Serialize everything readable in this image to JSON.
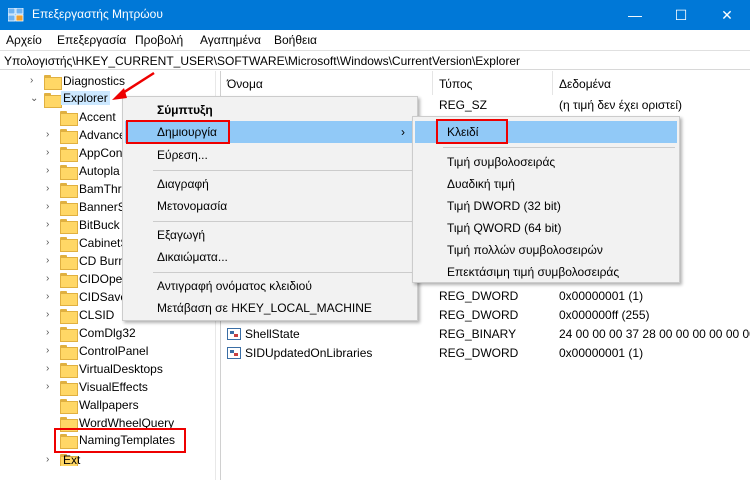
{
  "window": {
    "title": "Επεξεργαστής Μητρώου",
    "minimize": "—",
    "maximize": "☐",
    "close": "✕"
  },
  "menu": [
    "Αρχείο",
    "Επεξεργασία",
    "Προβολή",
    "Αγαπημένα",
    "Βοήθεια"
  ],
  "address": "Υπολογιστής\\HKEY_CURRENT_USER\\SOFTWARE\\Microsoft\\Windows\\CurrentVersion\\Explorer",
  "tree": {
    "items": [
      {
        "label": "Diagnostics",
        "chevron": "›"
      },
      {
        "label": "Explorer",
        "chevron": "⌄",
        "selected": true
      },
      {
        "label": "Accent",
        "chevron": ""
      },
      {
        "label": "Advance",
        "chevron": "›"
      },
      {
        "label": "AppCon",
        "chevron": "›"
      },
      {
        "label": "Autopla",
        "chevron": "›"
      },
      {
        "label": "BamThr",
        "chevron": "›"
      },
      {
        "label": "BannerS",
        "chevron": "›"
      },
      {
        "label": "BitBuck",
        "chevron": "›"
      },
      {
        "label": "CabinetS",
        "chevron": "›"
      },
      {
        "label": "CD Burn",
        "chevron": "›"
      },
      {
        "label": "CIDOper",
        "chevron": "›"
      },
      {
        "label": "CIDSave",
        "chevron": "›"
      },
      {
        "label": "CLSID",
        "chevron": "›"
      },
      {
        "label": "ComDlg32",
        "chevron": "›"
      },
      {
        "label": "ControlPanel",
        "chevron": "›"
      },
      {
        "label": "VirtualDesktops",
        "chevron": "›"
      },
      {
        "label": "VisualEffects",
        "chevron": "›"
      },
      {
        "label": "Wallpapers",
        "chevron": ""
      },
      {
        "label": "WordWheelQuery",
        "chevron": ""
      },
      {
        "label": "NamingTemplates",
        "chevron": ""
      },
      {
        "label": "Ext",
        "chevron": "›"
      }
    ]
  },
  "columns": {
    "name": "Όνομα",
    "type": "Τύπος",
    "data": "Δεδομένα"
  },
  "values": [
    {
      "name": "",
      "type": "REG_SZ",
      "data": "(η τιμή δεν έχει οριστεί)",
      "icon": false
    },
    {
      "name": "",
      "type": "REG_DWORD",
      "data": "0x00000001 (1)",
      "icon": false
    },
    {
      "name": "",
      "type": "REG_DWORD",
      "data": "0x000000ff (255)",
      "icon": false
    },
    {
      "name": "ShellState",
      "type": "REG_BINARY",
      "data": "24 00 00 00 37 28 00 00 00 00 00 00 00",
      "icon": true
    },
    {
      "name": "SIDUpdatedOnLibraries",
      "type": "REG_DWORD",
      "data": "0x00000001 (1)",
      "icon": true
    }
  ],
  "context_menu": {
    "items": [
      "Σύμπτυξη",
      "Δημιουργία",
      "Εύρεση...",
      "Διαγραφή",
      "Μετονομασία",
      "Εξαγωγή",
      "Δικαιώματα...",
      "Αντιγραφή ονόματος κλειδιού",
      "Μετάβαση σε HKEY_LOCAL_MACHINE"
    ],
    "submenu_arrow": "›"
  },
  "submenu": {
    "items": [
      "Κλειδί",
      "Τιμή συμβολοσειράς",
      "Δυαδική τιμή",
      "Τιμή DWORD (32 bit)",
      "Τιμή QWORD (64 bit)",
      "Τιμή πολλών συμβολοσειρών",
      "Επεκτάσιμη τιμή συμβολοσειράς"
    ]
  },
  "colors": {
    "titlebar": "#0078d7",
    "highlight": "#91c9f7",
    "annotation": "#e00000"
  }
}
